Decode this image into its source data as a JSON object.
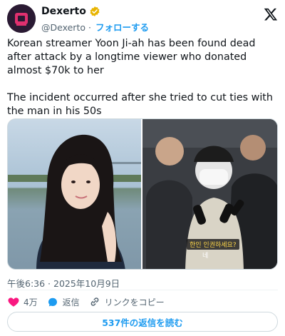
{
  "account": {
    "name": "Dexerto",
    "handle": "@Dexerto",
    "separator": "·",
    "follow_label": "フォローする"
  },
  "tweet": {
    "paragraphs": [
      "Korean streamer Yoon Ji-ah has been found dead after attack by a longtime viewer who donated almost $70k to her",
      "The incident occurred after she tried to cut ties with the man in his 50s"
    ],
    "timestamp": "午後6:36 · 2025年10月9日"
  },
  "media": {
    "caption_line": "한인 인권하세요?",
    "caption_sub": "네"
  },
  "actions": {
    "like_count": "4万",
    "reply_label": "返信",
    "copy_link_label": "リンクをコピー"
  },
  "read_replies_label": "537件の返信を読む",
  "colors": {
    "accent": "#1d9bf0",
    "like": "#f91880",
    "text": "#0f1419",
    "muted": "#536471",
    "verified": "#e8b400"
  }
}
